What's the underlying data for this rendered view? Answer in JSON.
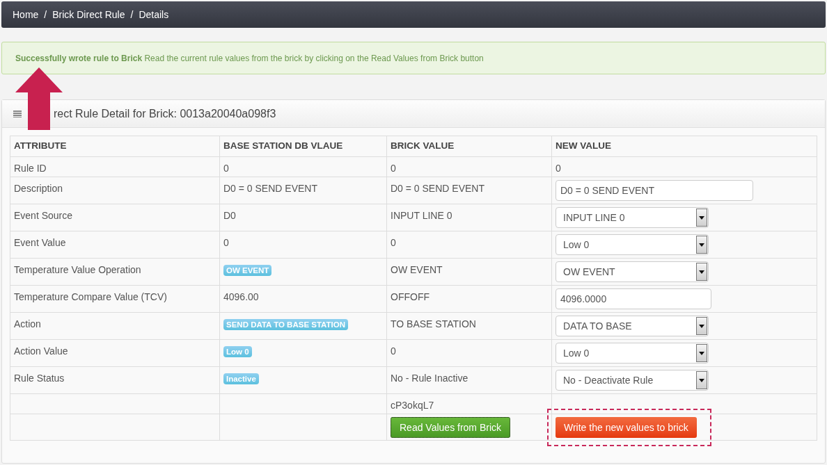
{
  "breadcrumb": [
    "Home",
    "Brick Direct Rule",
    "Details"
  ],
  "breadcrumb_separator": "/",
  "alert": {
    "title": "Successfully wrote rule to Brick",
    "message": "Read the current rule values from the brick by clicking on the Read Values from Brick button"
  },
  "panel": {
    "title": "rect Rule Detail for Brick: 0013a20040a098f3"
  },
  "table": {
    "columns": [
      "ATTRIBUTE",
      "BASE STATION DB VLAUE",
      "BRICK VALUE",
      "NEW VALUE"
    ],
    "rows": [
      {
        "attribute": "Rule ID",
        "db": {
          "kind": "text",
          "text": "0"
        },
        "brick": "0",
        "new": {
          "kind": "text",
          "value": "0"
        }
      },
      {
        "attribute": "Description",
        "db": {
          "kind": "text",
          "text": "D0 = 0 SEND EVENT"
        },
        "brick": "D0 = 0 SEND EVENT",
        "new": {
          "kind": "input",
          "value": "D0 = 0 SEND EVENT"
        }
      },
      {
        "attribute": "Event Source",
        "db": {
          "kind": "text",
          "text": "D0"
        },
        "brick": "INPUT LINE 0",
        "new": {
          "kind": "select",
          "value": "INPUT LINE 0"
        }
      },
      {
        "attribute": "Event Value",
        "db": {
          "kind": "text",
          "text": "0"
        },
        "brick": "0",
        "new": {
          "kind": "select",
          "value": "Low 0"
        }
      },
      {
        "attribute": "Temperature Value Operation",
        "db": {
          "kind": "label",
          "text": "OW EVENT"
        },
        "brick": "OW EVENT",
        "new": {
          "kind": "select",
          "value": "OW EVENT"
        }
      },
      {
        "attribute": "Temperature Compare Value (TCV)",
        "db": {
          "kind": "text",
          "text": "4096.00"
        },
        "brick": "OFFOFF",
        "new": {
          "kind": "input_short",
          "value": "4096.0000"
        }
      },
      {
        "attribute": "Action",
        "db": {
          "kind": "label",
          "text": "SEND DATA TO BASE STATION"
        },
        "brick": "TO BASE STATION",
        "new": {
          "kind": "select",
          "value": "DATA TO BASE"
        }
      },
      {
        "attribute": "Action Value",
        "db": {
          "kind": "label",
          "text": "Low 0"
        },
        "brick": "0",
        "new": {
          "kind": "select",
          "value": "Low 0"
        }
      },
      {
        "attribute": "Rule Status",
        "db": {
          "kind": "label",
          "text": "Inactive"
        },
        "brick": "No - Rule Inactive",
        "new": {
          "kind": "select",
          "value": "No - Deactivate Rule"
        }
      }
    ],
    "code": "cP3okqL7",
    "read_button": "Read Values from Brick",
    "write_button": "Write the new values to brick"
  }
}
